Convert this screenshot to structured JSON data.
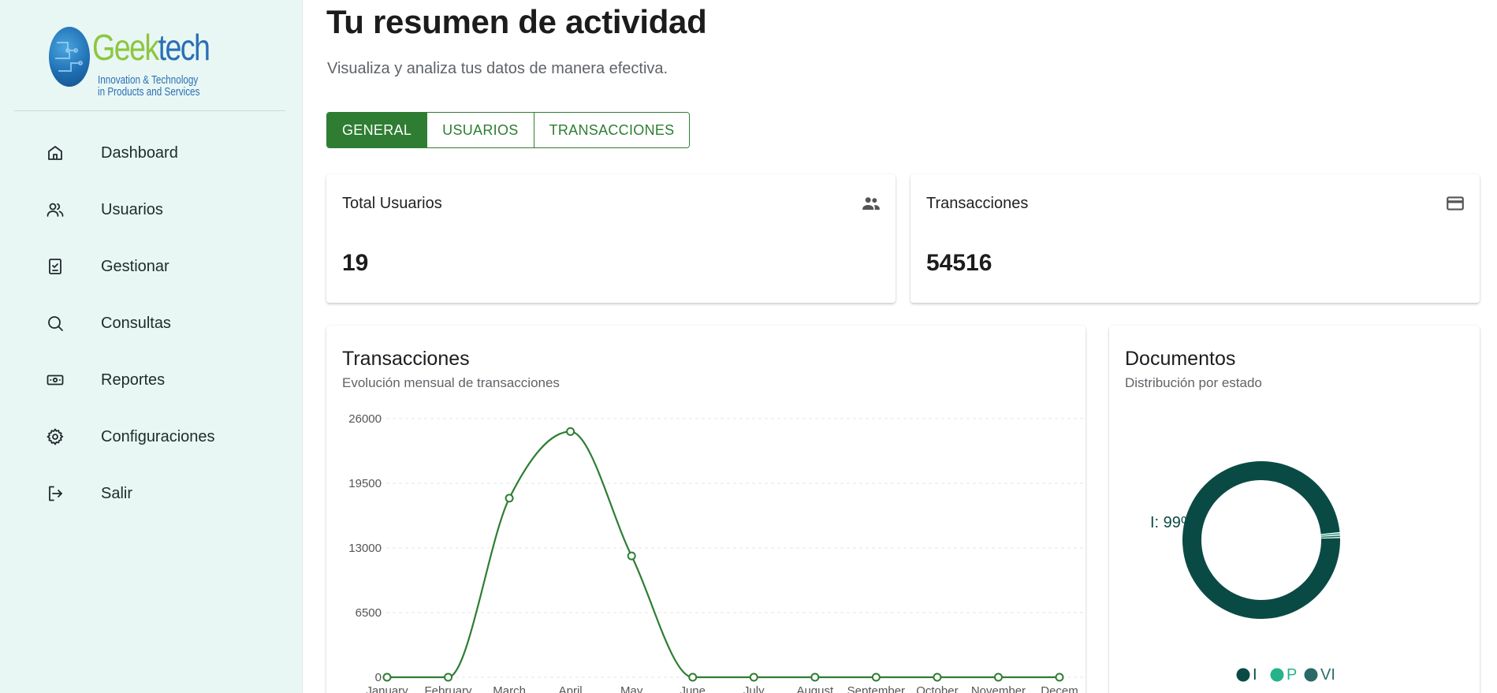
{
  "brand": {
    "name_part1": "Geek",
    "name_part2": "tech",
    "tagline_line1": "Innovation & Technology",
    "tagline_line2": "in Products and Services"
  },
  "sidebar": {
    "items": [
      {
        "label": "Dashboard",
        "icon": "home-icon"
      },
      {
        "label": "Usuarios",
        "icon": "users-icon"
      },
      {
        "label": "Gestionar",
        "icon": "clipboard-check-icon"
      },
      {
        "label": "Consultas",
        "icon": "search-icon"
      },
      {
        "label": "Reportes",
        "icon": "cash-icon"
      },
      {
        "label": "Configuraciones",
        "icon": "gear-icon"
      },
      {
        "label": "Salir",
        "icon": "logout-icon"
      }
    ]
  },
  "header": {
    "title": "Tu resumen de actividad",
    "subtitle": "Visualiza y analiza tus datos de manera efectiva."
  },
  "tabs": [
    {
      "label": "GENERAL",
      "active": true
    },
    {
      "label": "USUARIOS",
      "active": false
    },
    {
      "label": "TRANSACCIONES",
      "active": false
    }
  ],
  "stats": [
    {
      "label": "Total Usuarios",
      "value": "19",
      "icon": "group-icon"
    },
    {
      "label": "Transacciones",
      "value": "54516",
      "icon": "credit-card-icon"
    }
  ],
  "colors": {
    "accent": "#2e7d32",
    "sidebar_bg": "#e8f7f4",
    "donut_i": "#0a4a45",
    "donut_p": "#26b38a",
    "donut_vi": "#2a6a66"
  },
  "transactions_chart": {
    "title": "Transacciones",
    "subtitle": "Evolución mensual de transacciones"
  },
  "documents_chart": {
    "title": "Documentos",
    "subtitle": "Distribución por estado"
  },
  "chart_data": [
    {
      "type": "line",
      "title": "Transacciones",
      "subtitle": "Evolución mensual de transacciones",
      "categories": [
        "January",
        "February",
        "March",
        "April",
        "May",
        "June",
        "July",
        "August",
        "September",
        "October",
        "November",
        "Decem"
      ],
      "series": [
        {
          "values": [
            0,
            0,
            18000,
            24700,
            12200,
            0,
            0,
            0,
            0,
            0,
            0,
            0
          ],
          "color": "#2e7d32"
        }
      ],
      "yticks": [
        "0",
        "6500",
        "13000",
        "19500",
        "26000"
      ],
      "ylim": [
        0,
        26000
      ],
      "grid": true
    },
    {
      "type": "pie",
      "title": "Documentos",
      "subtitle": "Distribución por estado",
      "labels": [
        "I",
        "P",
        "VI"
      ],
      "values": [
        99,
        0.5,
        0.5
      ],
      "colors": [
        "#0a4a45",
        "#26b38a",
        "#2a6a66"
      ],
      "slice_label": "I: 99%",
      "legend": "bottom"
    }
  ]
}
